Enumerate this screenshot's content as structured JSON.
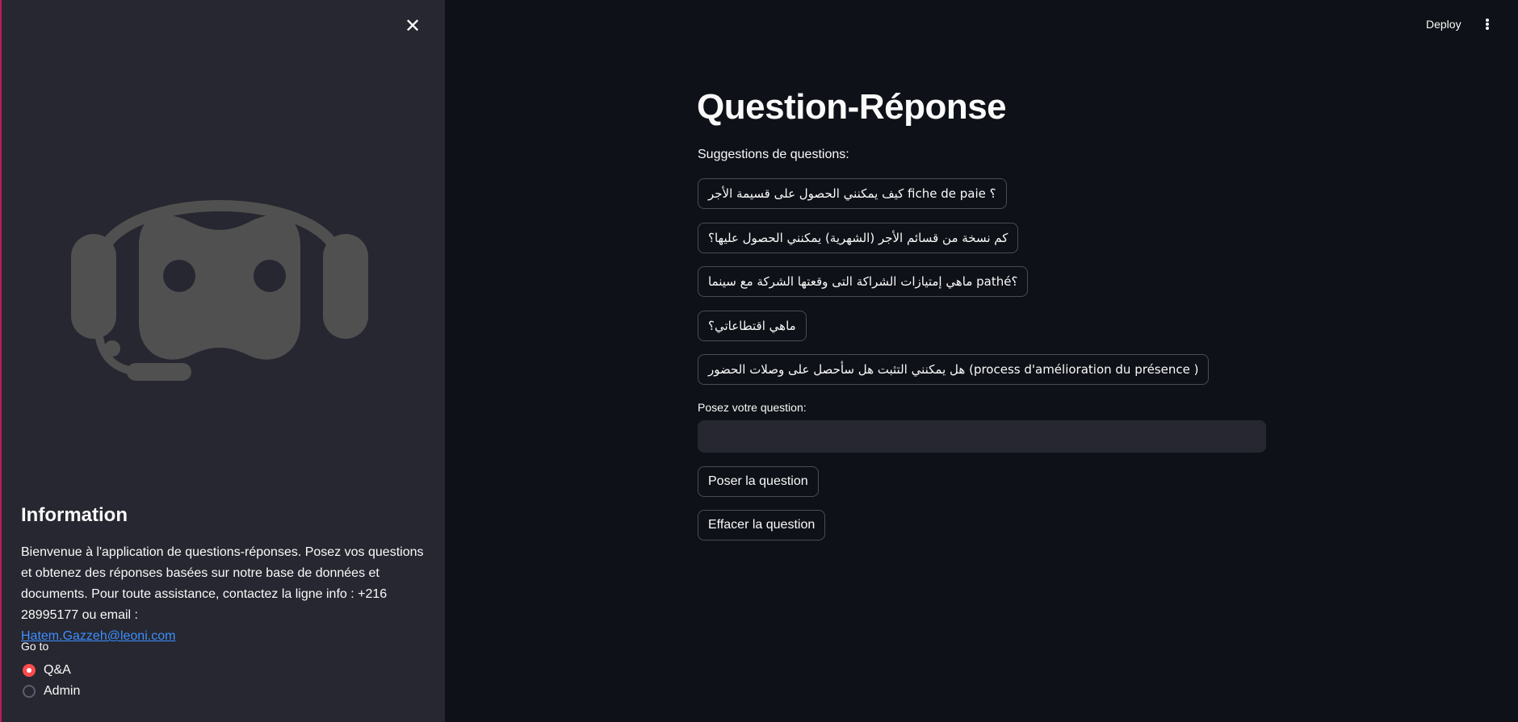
{
  "sidebar": {
    "close_icon": "close-icon",
    "logo_icon": "chatbot-headset-icon",
    "info_title": "Information",
    "info_text": "Bienvenue à l'application de questions-réponses. Posez vos questions et obtenez des réponses basées sur notre base de données et documents. Pour toute assistance, contactez la ligne info : +216 28995177 ou email :",
    "info_email": "Hatem.Gazzeh@leoni.com",
    "goto_label": "Go to",
    "nav_options": [
      {
        "label": "Q&A",
        "selected": true
      },
      {
        "label": "Admin",
        "selected": false
      }
    ],
    "accent_color": "#ff4b4b"
  },
  "header": {
    "deploy_label": "Deploy",
    "menu_icon": "vertical-dots-icon"
  },
  "main": {
    "title": "Question-Réponse",
    "suggestions_label": "Suggestions de questions:",
    "suggestions": [
      "كيف يمكنني الحصول على قسيمة الأجر fiche de paie ؟",
      "كم نسخة من قسائم الأجر (الشهرية) يمكنني الحصول عليها؟",
      "ماهي إمتيازات الشراكة التى وقعتها الشركة مع سينما pathé؟",
      "ماهي اقتطاعاتي؟",
      "هل يمكنني التثبت هل سأحصل على وصلات الحضور (process d'amélioration du présence )"
    ],
    "question_label": "Posez votre question:",
    "question_value": "",
    "ask_button": "Poser la question",
    "clear_button": "Effacer la question"
  }
}
